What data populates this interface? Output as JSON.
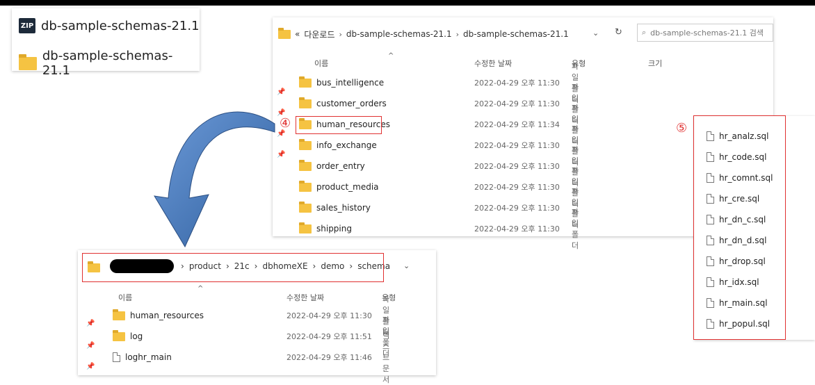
{
  "zip_panel": {
    "zip_name": "db-sample-schemas-21.1",
    "folder_name": "db-sample-schemas-21.1",
    "zip_icon_label": "ZIP"
  },
  "explorer_main": {
    "breadcrumb": [
      "«",
      "다운로드",
      "db-sample-schemas-21.1",
      "db-sample-schemas-21.1"
    ],
    "search_placeholder": "db-sample-schemas-21.1 검색",
    "columns": {
      "name": "이름",
      "modified": "수정한 날짜",
      "type": "유형",
      "size": "크기"
    },
    "rows": [
      {
        "name": "bus_intelligence",
        "modified": "2022-04-29 오후 11:30",
        "type": "파일 폴더"
      },
      {
        "name": "customer_orders",
        "modified": "2022-04-29 오후 11:30",
        "type": "파일 폴더"
      },
      {
        "name": "human_resources",
        "modified": "2022-04-29 오후 11:34",
        "type": "파일 폴더"
      },
      {
        "name": "info_exchange",
        "modified": "2022-04-29 오후 11:30",
        "type": "파일 폴더"
      },
      {
        "name": "order_entry",
        "modified": "2022-04-29 오후 11:30",
        "type": "파일 폴더"
      },
      {
        "name": "product_media",
        "modified": "2022-04-29 오후 11:30",
        "type": "파일 폴더"
      },
      {
        "name": "sales_history",
        "modified": "2022-04-29 오후 11:30",
        "type": "파일 폴더"
      },
      {
        "name": "shipping",
        "modified": "2022-04-29 오후 11:30",
        "type": "파일 폴더"
      }
    ]
  },
  "explorer_target": {
    "breadcrumb": [
      "product",
      "21c",
      "dbhomeXE",
      "demo",
      "schema"
    ],
    "columns": {
      "name": "이름",
      "modified": "수정한 날짜",
      "type": "유형"
    },
    "rows": [
      {
        "name": "human_resources",
        "modified": "2022-04-29 오후 11:30",
        "type": "파일 폴더",
        "kind": "folder"
      },
      {
        "name": "log",
        "modified": "2022-04-29 오후 11:51",
        "type": "파일 폴더",
        "kind": "folder"
      },
      {
        "name": "loghr_main",
        "modified": "2022-04-29 오후 11:46",
        "type": "텍스트 문서",
        "kind": "file"
      }
    ]
  },
  "sql_files": {
    "items": [
      "hr_analz.sql",
      "hr_code.sql",
      "hr_comnt.sql",
      "hr_cre.sql",
      "hr_dn_c.sql",
      "hr_dn_d.sql",
      "hr_drop.sql",
      "hr_idx.sql",
      "hr_main.sql",
      "hr_popul.sql"
    ]
  },
  "annotations": {
    "step4": "④",
    "step5": "⑤",
    "highlight_color": "#e03030",
    "arrow_color": "#4a7fc0"
  }
}
